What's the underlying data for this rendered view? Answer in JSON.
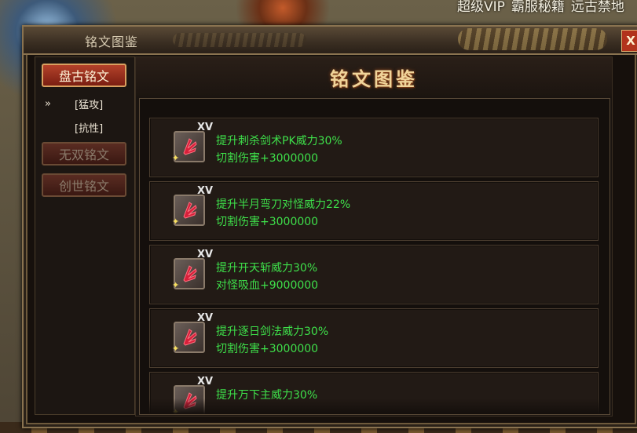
{
  "background": {
    "top_text": [
      "超级VIP",
      "霸服秘籍",
      "远古禁地"
    ]
  },
  "window": {
    "title": "铭文图鉴",
    "close_label": "X"
  },
  "sidebar": {
    "tabs": [
      {
        "label": "盘古铭文",
        "state": "active"
      },
      {
        "label": "无双铭文",
        "state": "inactive"
      },
      {
        "label": "创世铭文",
        "state": "inactive"
      }
    ],
    "subitems": [
      {
        "label": "[猛攻]",
        "selected": true,
        "marker": "»"
      },
      {
        "label": "[抗性]",
        "selected": false
      }
    ]
  },
  "content": {
    "header": "铭文图鉴",
    "cards": [
      {
        "rank": "XV",
        "line1": "提升刺杀剑术PK威力30%",
        "line2": "切割伤害+3000000",
        "icon": "red-claw-icon"
      },
      {
        "rank": "XV",
        "line1": "提升半月弯刀对怪威力22%",
        "line2": "切割伤害+3000000",
        "icon": "red-claw-icon"
      },
      {
        "rank": "XV",
        "line1": "提升开天斩威力30%",
        "line2": "对怪吸血+9000000",
        "icon": "red-claw-icon"
      },
      {
        "rank": "XV",
        "line1": "提升逐日剑法威力30%",
        "line2": "切割伤害+3000000",
        "icon": "red-claw-icon"
      },
      {
        "rank": "XV",
        "line1": "提升万下主威力30%",
        "line2": "",
        "icon": "red-claw-icon"
      }
    ]
  },
  "colors": {
    "effect_text": "#3ee04a",
    "active_tab": "#b4422a",
    "frame": "#8a7350"
  }
}
